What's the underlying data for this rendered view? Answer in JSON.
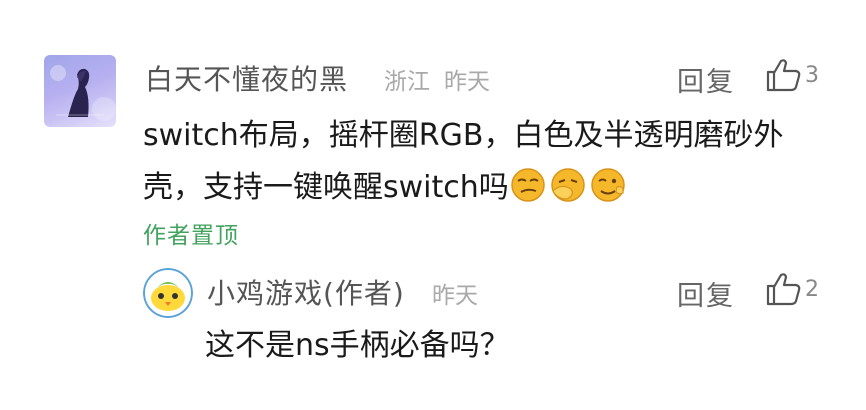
{
  "comment": {
    "username": "白天不懂夜的黑",
    "location": "浙江",
    "time": "昨天",
    "reply_label": "回复",
    "like_count": "3",
    "content_line1": "switch布局，摇杆圈RGB，白色及半透明磨砂外",
    "content_line2": "壳，支持一键唤醒switch吗",
    "emojis": [
      "smirk-emoji",
      "facepalm-emoji",
      "wink-emoji"
    ],
    "pinned_label": "作者置顶"
  },
  "reply": {
    "username": "小鸡游戏(作者)",
    "time": "昨天",
    "reply_label": "回复",
    "like_count": "2",
    "content": "这不是ns手柄必备吗？"
  },
  "colors": {
    "pinned": "#41a35d",
    "meta": "#a9a9a9",
    "emoji": "#f5b82a"
  }
}
